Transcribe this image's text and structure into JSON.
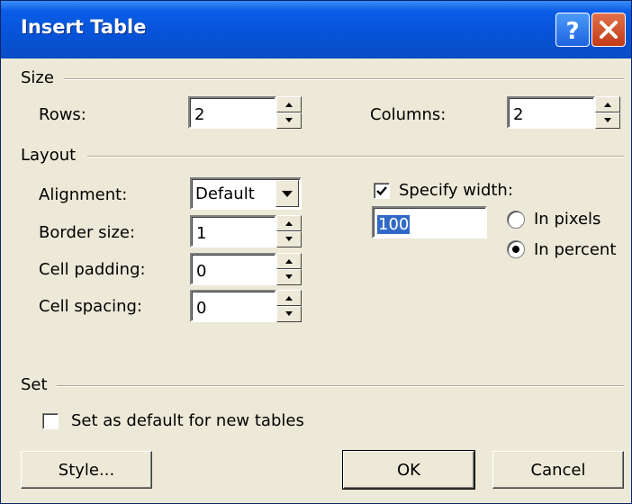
{
  "dialog": {
    "title": "Insert Table",
    "help_icon": "help-icon",
    "close_icon": "close-icon"
  },
  "size": {
    "group_label": "Size",
    "rows_label": "Rows:",
    "rows_value": "2",
    "columns_label": "Columns:",
    "columns_value": "2"
  },
  "layout": {
    "group_label": "Layout",
    "alignment_label": "Alignment:",
    "alignment_value": "Default",
    "border_label": "Border size:",
    "border_value": "1",
    "padding_label": "Cell padding:",
    "padding_value": "0",
    "spacing_label": "Cell spacing:",
    "spacing_value": "0",
    "specify_width_label": "Specify width:",
    "specify_width_checked": true,
    "width_value": "100",
    "pixels_label": "In pixels",
    "pixels_selected": false,
    "percent_label": "In percent",
    "percent_selected": true
  },
  "set": {
    "group_label": "Set",
    "default_label": "Set as default for new tables",
    "default_checked": false
  },
  "buttons": {
    "style": "Style...",
    "ok": "OK",
    "cancel": "Cancel"
  },
  "colors": {
    "titlebar": "#0753d7",
    "face": "#ece9d8",
    "selection": "#316ac5",
    "close": "#c33b17"
  }
}
